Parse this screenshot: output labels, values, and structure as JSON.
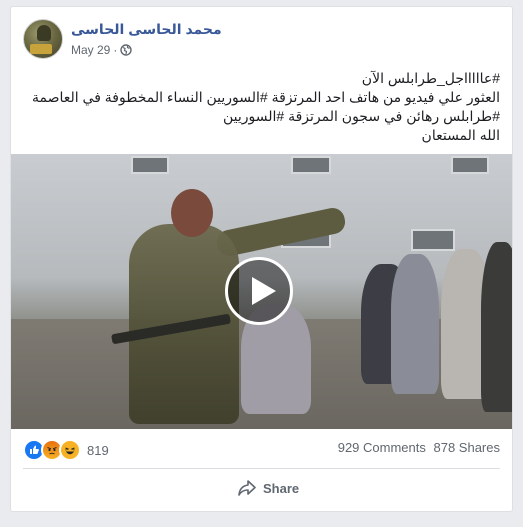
{
  "post": {
    "author": "محمد الحاسى الحاسى",
    "date": "May 29",
    "separator": "·",
    "privacy_icon": "globe-icon",
    "text_lines": [
      "#عاااااجل_طرابلس الآن",
      "العثور علي فيديو من هاتف احد المرتزقة #السوريين النساء المخطوفة في العاصمة",
      "#طرابلس رهائن في سجون المرتزقة #السوريين",
      "الله المستعان"
    ]
  },
  "video": {
    "play_icon": "play-icon"
  },
  "stats": {
    "reaction_icons": [
      "like-icon",
      "angry-icon",
      "haha-icon"
    ],
    "reactions_count": "819",
    "comments": "929 Comments",
    "shares": "878 Shares"
  },
  "actions": {
    "share_label": "Share",
    "share_icon": "share-icon"
  },
  "colors": {
    "author": "#385898",
    "meta": "#606770",
    "background": "#e9ebee",
    "like": "#1877f2"
  }
}
